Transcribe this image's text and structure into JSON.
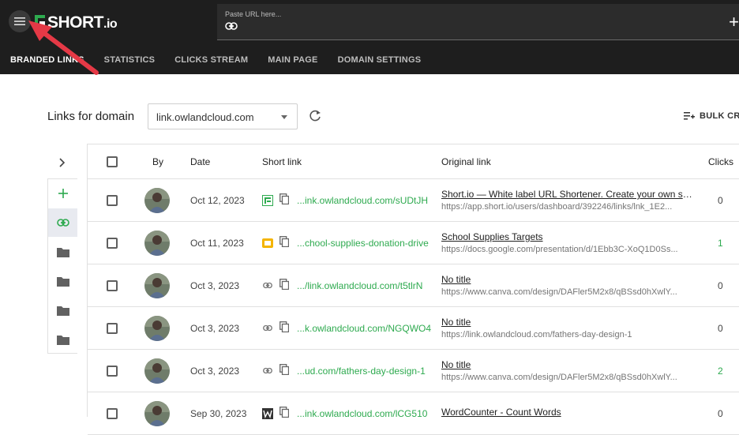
{
  "brand": {
    "name": "SHORT",
    "suffix": ".io"
  },
  "url_input": {
    "placeholder": "Paste URL here..."
  },
  "nav": {
    "tabs": [
      {
        "label": "BRANDED LINKS",
        "active": true
      },
      {
        "label": "STATISTICS",
        "active": false
      },
      {
        "label": "CLICKS STREAM",
        "active": false
      },
      {
        "label": "MAIN PAGE",
        "active": false
      },
      {
        "label": "DOMAIN SETTINGS",
        "active": false
      }
    ]
  },
  "toolbar": {
    "title": "Links for domain",
    "domain": "link.owlandcloud.com",
    "bulk_label": "BULK CR"
  },
  "table": {
    "headers": {
      "by": "By",
      "date": "Date",
      "short": "Short link",
      "original": "Original link",
      "clicks": "Clicks"
    },
    "rows": [
      {
        "date": "Oct 12, 2023",
        "favicon": "short-io-icon",
        "short": "...ink.owlandcloud.com/sUDtJH",
        "title": "Short.io — White label URL Shortener. Create your own short ...",
        "url": "https://app.short.io/users/dashboard/392246/links/lnk_1E2...",
        "clicks": "0"
      },
      {
        "date": "Oct 11, 2023",
        "favicon": "slides-icon",
        "short": "...chool-supplies-donation-drive",
        "title": "School Supplies Targets",
        "url": "https://docs.google.com/presentation/d/1Ebb3C-XoQ1D0Ss...",
        "clicks": "1"
      },
      {
        "date": "Oct 3, 2023",
        "favicon": "link-icon",
        "short": ".../link.owlandcloud.com/t5tlrN",
        "title": "No title",
        "url": "https://www.canva.com/design/DAFler5M2x8/qBSsd0hXwlY...",
        "clicks": "0"
      },
      {
        "date": "Oct 3, 2023",
        "favicon": "link-icon",
        "short": "...k.owlandcloud.com/NGQWO4",
        "title": "No title",
        "url": "https://link.owlandcloud.com/fathers-day-design-1",
        "clicks": "0"
      },
      {
        "date": "Oct 3, 2023",
        "favicon": "link-icon",
        "short": "...ud.com/fathers-day-design-1",
        "title": "No title",
        "url": "https://www.canva.com/design/DAFler5M2x8/qBSsd0hXwlY...",
        "clicks": "2"
      },
      {
        "date": "Sep 30, 2023",
        "favicon": "wordcounter-icon",
        "short": "...ink.owlandcloud.com/lCG510",
        "title": "WordCounter - Count Words",
        "url": "",
        "clicks": "0"
      }
    ]
  },
  "colors": {
    "accent": "#2eaa4f",
    "header_bg": "#1e1e1e",
    "arrow": "#e53946"
  }
}
